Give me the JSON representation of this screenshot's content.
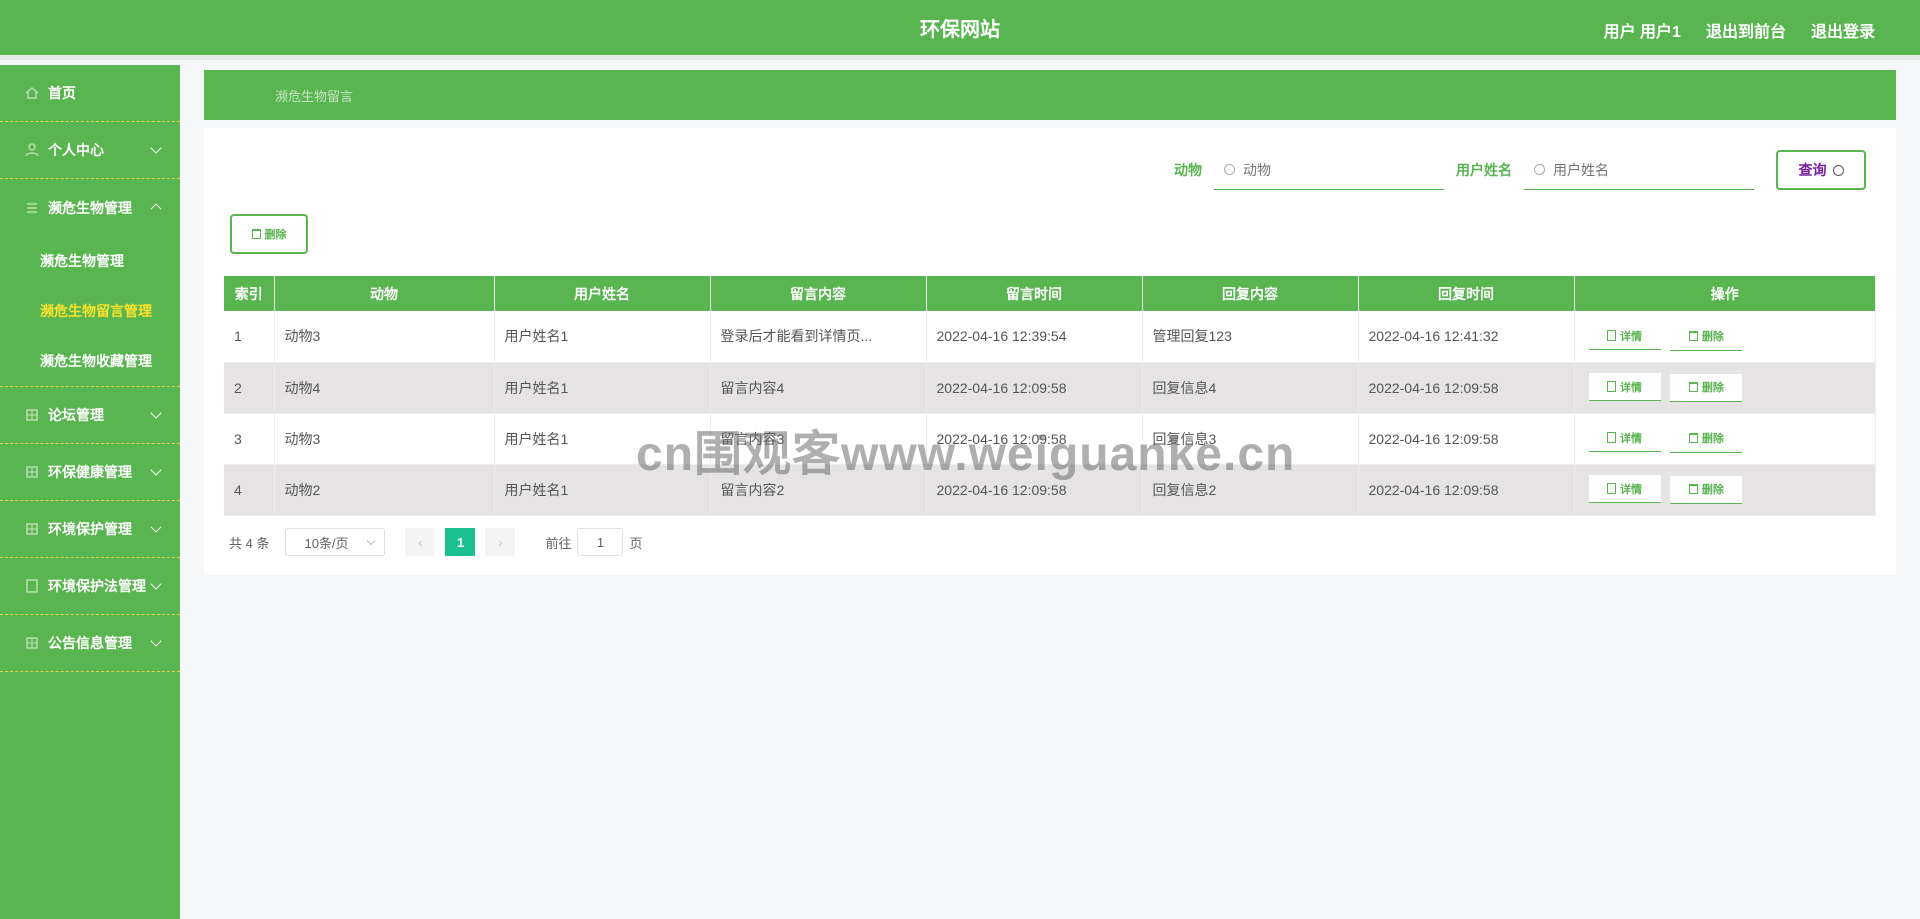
{
  "header": {
    "site_title": "环保网站",
    "user_label": "用户 用户1",
    "back_to_front": "退出到前台",
    "logout": "退出登录"
  },
  "sidebar": {
    "items": [
      {
        "label": "首页",
        "icon": "home-icon"
      },
      {
        "label": "个人中心",
        "icon": "user-icon"
      },
      {
        "label": "濒危生物管理",
        "icon": "list-icon",
        "expanded": true,
        "children": [
          {
            "label": "濒危生物管理"
          },
          {
            "label": "濒危生物留言管理",
            "active": true
          },
          {
            "label": "濒危生物收藏管理"
          }
        ]
      },
      {
        "label": "论坛管理",
        "icon": "grid-icon"
      },
      {
        "label": "环保健康管理",
        "icon": "grid-icon"
      },
      {
        "label": "环境保护管理",
        "icon": "grid-icon"
      },
      {
        "label": "环境保护法管理",
        "icon": "doc-icon"
      },
      {
        "label": "公告信息管理",
        "icon": "grid-icon"
      }
    ]
  },
  "breadcrumb": "濒危生物留言",
  "search": {
    "animal_label": "动物",
    "animal_placeholder": "动物",
    "username_label": "用户姓名",
    "username_placeholder": "用户姓名",
    "query_button": "查询"
  },
  "toolbar": {
    "delete_label": "删除"
  },
  "table": {
    "headers": [
      "索引",
      "动物",
      "用户姓名",
      "留言内容",
      "留言时间",
      "回复内容",
      "回复时间",
      "操作"
    ],
    "rows": [
      [
        "1",
        "动物3",
        "用户姓名1",
        "登录后才能看到详情页...",
        "2022-04-16 12:39:54",
        "管理回复123",
        "2022-04-16 12:41:32"
      ],
      [
        "2",
        "动物4",
        "用户姓名1",
        "留言内容4",
        "2022-04-16 12:09:58",
        "回复信息4",
        "2022-04-16 12:09:58"
      ],
      [
        "3",
        "动物3",
        "用户姓名1",
        "留言内容3",
        "2022-04-16 12:09:58",
        "回复信息3",
        "2022-04-16 12:09:58"
      ],
      [
        "4",
        "动物2",
        "用户姓名1",
        "留言内容2",
        "2022-04-16 12:09:58",
        "回复信息2",
        "2022-04-16 12:09:58"
      ]
    ],
    "detail_label": "详情",
    "delete_label": "删除"
  },
  "pagination": {
    "total": "共 4 条",
    "page_size": "10条/页",
    "current_page": "1",
    "goto_prefix": "前往",
    "goto_value": "1",
    "goto_suffix": "页"
  },
  "watermark": "cn围观客www.weiguanke.cn",
  "colors": {
    "primary": "#58b550",
    "active_menu": "#f8e22b",
    "page_active": "#1cbf8e"
  }
}
